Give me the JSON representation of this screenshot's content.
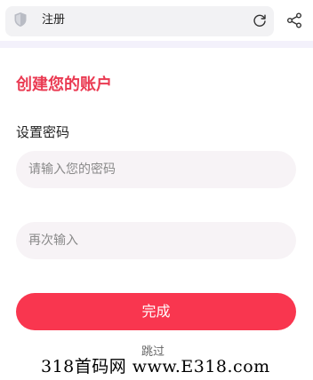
{
  "topbar": {
    "title": "注册",
    "icons": [
      "shield-icon",
      "refresh-icon",
      "share-icon"
    ]
  },
  "form": {
    "heading": "创建您的账户",
    "password_label": "设置密码",
    "password_placeholder": "请输入您的密码",
    "confirm_placeholder": "再次输入",
    "submit_label": "完成",
    "skip_label": "跳过"
  },
  "watermark": {
    "text": "318首码网 www.E318.com"
  },
  "colors": {
    "accent": "#ea3a52",
    "button": "#f9364f",
    "input_bg": "#f7f3f6"
  }
}
